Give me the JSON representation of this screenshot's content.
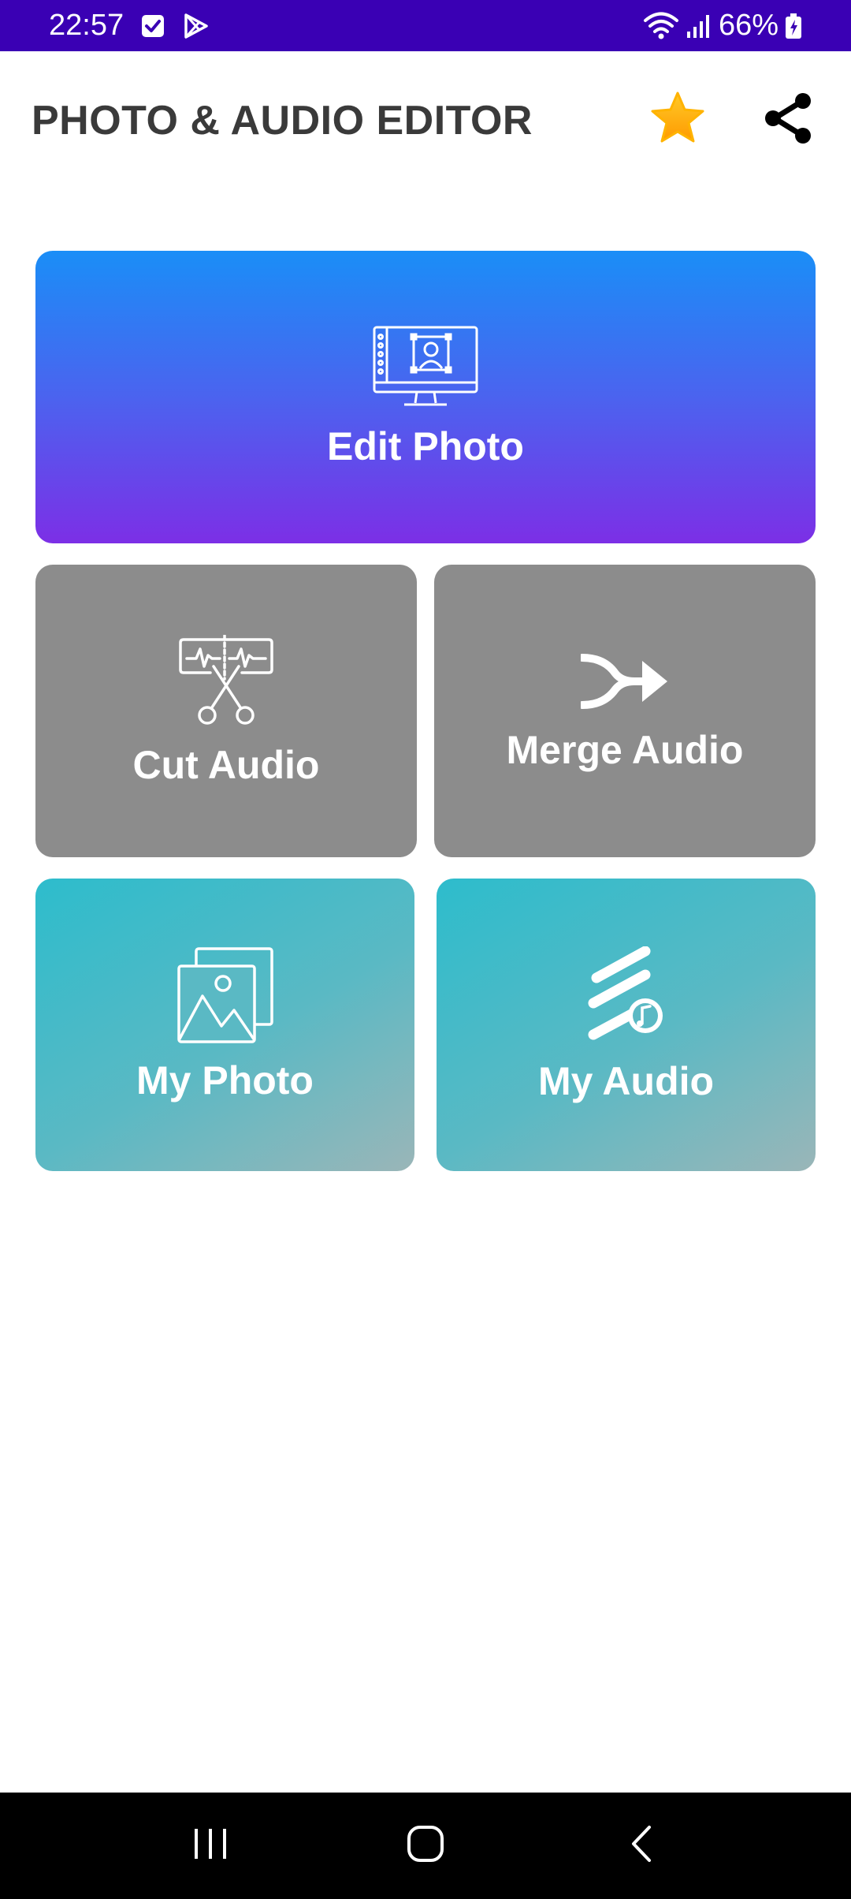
{
  "status_bar": {
    "time": "22:57",
    "battery": "66%",
    "icons": [
      "checkbox-notification-icon",
      "play-store-icon",
      "wifi-icon",
      "signal-icon",
      "battery-icon"
    ]
  },
  "app_bar": {
    "title": "PHOTO & AUDIO EDITOR",
    "actions": [
      "star-rate-icon",
      "share-icon"
    ]
  },
  "tiles": {
    "edit_photo": {
      "label": "Edit Photo",
      "icon": "monitor-portrait-icon"
    },
    "cut_audio": {
      "label": "Cut Audio",
      "icon": "waveform-scissors-icon"
    },
    "merge_audio": {
      "label": "Merge Audio",
      "icon": "merge-arrow-icon"
    },
    "my_photo": {
      "label": "My Photo",
      "icon": "photo-gallery-icon"
    },
    "my_audio": {
      "label": "My Audio",
      "icon": "music-file-icon"
    }
  },
  "nav_bar": {
    "buttons": [
      "recents-icon",
      "home-icon",
      "back-icon"
    ]
  },
  "colors": {
    "status_bar_bg": "#3a00b4",
    "edit_gradient_top": "#1a8ef7",
    "edit_gradient_bottom": "#7c2fe6",
    "audio_tile_bg": "#8c8c8c",
    "teal_gradient_start": "#2dbccc",
    "teal_gradient_end": "#9ab6b8",
    "star": "#ffb300",
    "title_text": "#3a3a3a"
  }
}
